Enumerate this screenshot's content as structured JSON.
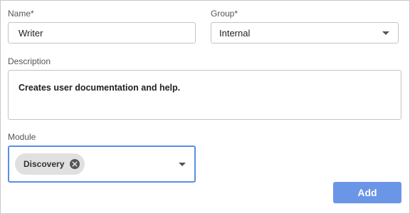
{
  "form": {
    "name": {
      "label": "Name*",
      "value": "Writer"
    },
    "group": {
      "label": "Group*",
      "value": "Internal"
    },
    "description": {
      "label": "Description",
      "value": "Creates user documentation and help."
    },
    "module": {
      "label": "Module",
      "chips": [
        "Discovery"
      ]
    },
    "add_label": "Add"
  },
  "colors": {
    "accent": "#5b8ee6",
    "button": "#6b95e6",
    "border": "#c4c4c4",
    "chip": "#e0e0e0"
  },
  "icons": {
    "chip_remove": "close-circle-icon",
    "dropdown": "chevron-down-icon"
  }
}
